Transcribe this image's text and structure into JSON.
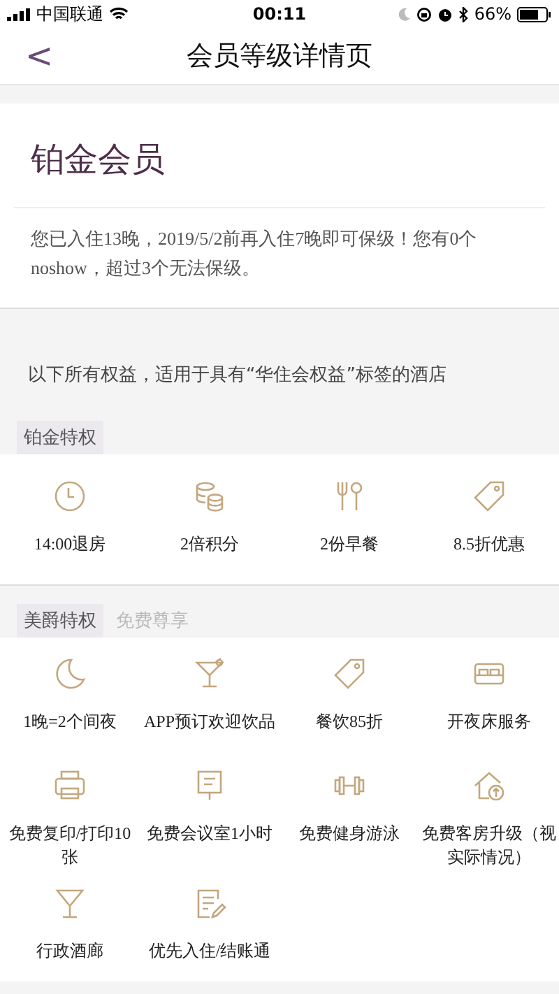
{
  "status_bar": {
    "carrier": "中国联通",
    "time": "00:11",
    "battery": "66%"
  },
  "nav": {
    "back": "<",
    "title": "会员等级详情页"
  },
  "member": {
    "level": "铂金会员",
    "notice": "您已入住13晚，2019/5/2前再入住7晚即可保级！您有0个noshow，超过3个无法保级。"
  },
  "scope_note": "以下所有权益，适用于具有“华住会权益”标签的酒店",
  "sections": [
    {
      "tabs": [
        {
          "label": "铂金特权",
          "selected": true
        }
      ],
      "benefits": [
        {
          "kind": "clock",
          "label": "14:00退房"
        },
        {
          "kind": "coins",
          "label": "2倍积分"
        },
        {
          "kind": "cutlery",
          "label": "2份早餐"
        },
        {
          "kind": "tag",
          "label": "8.5折优惠"
        }
      ]
    },
    {
      "tabs": [
        {
          "label": "美爵特权",
          "selected": true
        },
        {
          "label": "免费尊享",
          "selected": false
        }
      ],
      "benefits": [
        {
          "kind": "moon",
          "label": "1晚=2个间夜"
        },
        {
          "kind": "cocktail",
          "label": "APP预订欢迎饮品"
        },
        {
          "kind": "tag",
          "label": "餐饮85折"
        },
        {
          "kind": "bed",
          "label": "开夜床服务"
        },
        {
          "kind": "printer",
          "label": "免费复印/打印10张"
        },
        {
          "kind": "board",
          "label": "免费会议室1小时"
        },
        {
          "kind": "dumbbell",
          "label": "免费健身游泳"
        },
        {
          "kind": "house",
          "label": "免费客房升级（视实际情况）"
        },
        {
          "kind": "glass",
          "label": "行政酒廊"
        },
        {
          "kind": "note",
          "label": "优先入住/结账通"
        }
      ]
    }
  ]
}
